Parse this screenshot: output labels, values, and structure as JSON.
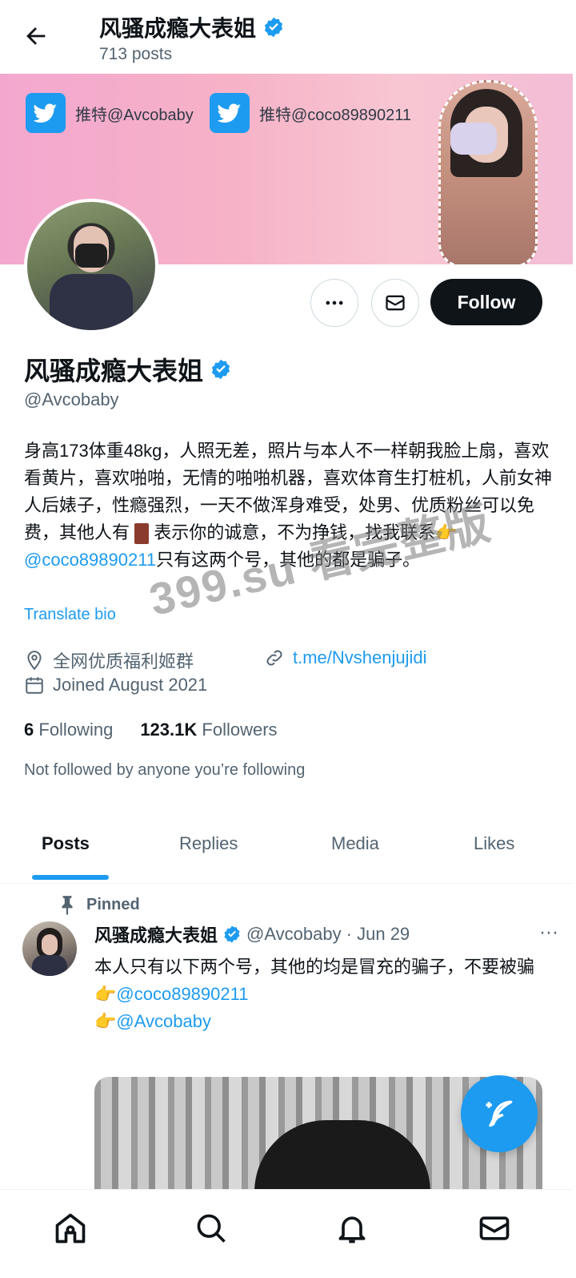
{
  "header": {
    "title": "风骚成瘾大表姐",
    "posts_count": "713 posts"
  },
  "banner": {
    "chip1": "推特@Avcobaby",
    "chip2": "推特@coco89890211"
  },
  "profile": {
    "name": "风骚成瘾大表姐",
    "handle": "@Avcobaby",
    "bio_part1": "身高173体重48kg，人照无差，照片与本人不一样朝我脸上扇，喜欢看黄片，喜欢啪啪，无情的啪啪机器，喜欢体育生打桩机，人前女神人后婊子，性瘾强烈，一天不做浑身难受，处男、优质粉丝可以免费，其他人有",
    "bio_part2": "表示你的诚意，不为挣钱，找我联系",
    "bio_emoji": "👉",
    "bio_link": "@coco89890211",
    "bio_part3": "只有这两个号，其他的都是骗子。",
    "translate": "Translate bio",
    "location": "全网优质福利姬群",
    "url": "t.me/Nvshenjujidi",
    "joined": "Joined August 2021",
    "following_count": "6",
    "following_label": "Following",
    "followers_count": "123.1K",
    "followers_label": "Followers",
    "not_followed": "Not followed by anyone you’re following",
    "follow_button": "Follow"
  },
  "tabs": [
    "Posts",
    "Replies",
    "Media",
    "Likes"
  ],
  "post": {
    "pinned_label": "Pinned",
    "author": "风骚成瘾大表姐",
    "handle_date": "@Avcobaby · Jun 29",
    "text_line1": "本人只有以下两个号，其他的均是冒充的骗子，不要被骗",
    "emoji": "👉",
    "mention1": "@coco89890211",
    "mention2": "@Avcobaby",
    "more": "···"
  },
  "watermark": "399.su 看完整版",
  "colors": {
    "accent": "#1d9bf0",
    "text": "#0f1419",
    "secondary": "#536471"
  },
  "icons": [
    "back-arrow-icon",
    "verified-icon",
    "twitter-bird-icon",
    "more-icon",
    "mail-icon",
    "location-icon",
    "link-icon",
    "calendar-icon",
    "pin-icon",
    "compose-icon",
    "home-icon",
    "search-icon",
    "bell-icon",
    "messages-icon"
  ]
}
